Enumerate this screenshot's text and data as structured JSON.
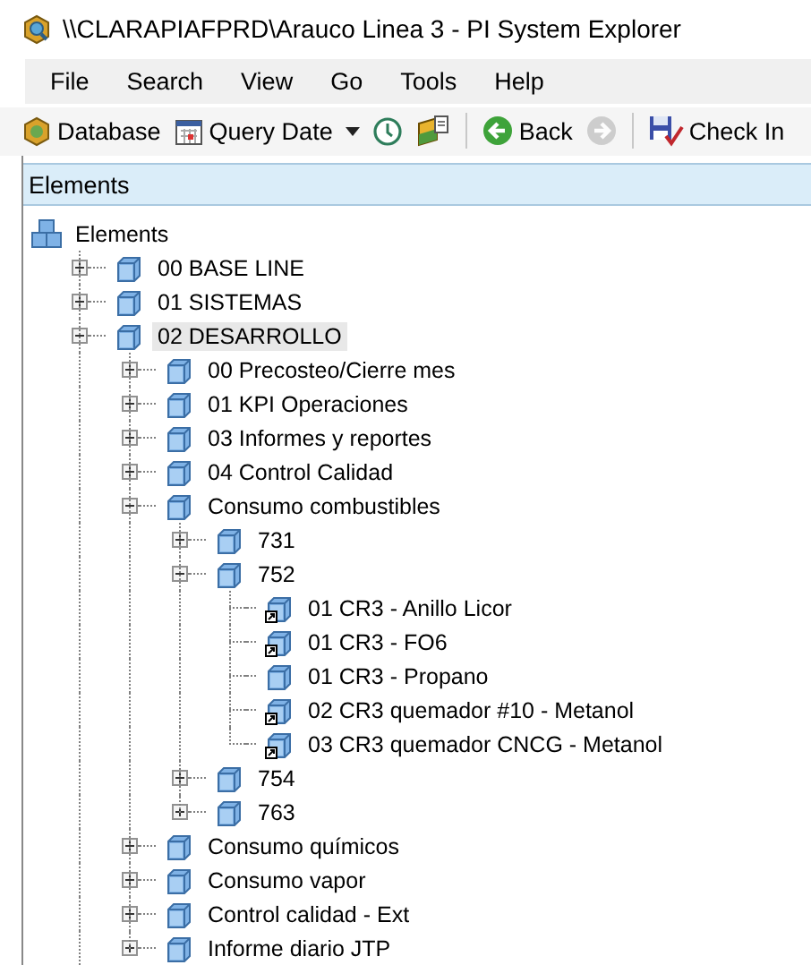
{
  "window": {
    "title": "\\\\CLARAPIAFPRD\\Arauco Linea 3 - PI System Explorer"
  },
  "menu": [
    "File",
    "Search",
    "View",
    "Go",
    "Tools",
    "Help"
  ],
  "toolbar": [
    {
      "kind": "database",
      "label": "Database"
    },
    {
      "kind": "calendar",
      "label": "Query Date"
    },
    {
      "kind": "dropdown"
    },
    {
      "kind": "clock"
    },
    {
      "kind": "layers"
    },
    {
      "kind": "separator"
    },
    {
      "kind": "back",
      "label": "Back",
      "disabled": false
    },
    {
      "kind": "forward",
      "disabled": true
    },
    {
      "kind": "separator"
    },
    {
      "kind": "checkin",
      "label": "Check In"
    }
  ],
  "panel": {
    "title": "Elements"
  },
  "tree": {
    "label": "Elements",
    "children": [
      {
        "label": "00 BASE LINE",
        "kind": "element",
        "expanded": false,
        "selected": false
      },
      {
        "label": "01 SISTEMAS",
        "kind": "element",
        "expanded": false,
        "selected": false
      },
      {
        "label": "02 DESARROLLO",
        "kind": "element",
        "expanded": true,
        "selected": true,
        "children": [
          {
            "label": "00 Precosteo/Cierre mes",
            "kind": "element",
            "expanded": false,
            "selected": false
          },
          {
            "label": "01 KPI Operaciones",
            "kind": "element",
            "expanded": false,
            "selected": false
          },
          {
            "label": "03 Informes y reportes",
            "kind": "element",
            "expanded": false,
            "selected": false
          },
          {
            "label": "04 Control Calidad",
            "kind": "element",
            "expanded": false,
            "selected": false
          },
          {
            "label": "Consumo combustibles",
            "kind": "element",
            "expanded": true,
            "selected": false,
            "children": [
              {
                "label": "731",
                "kind": "element",
                "expanded": false,
                "selected": false
              },
              {
                "label": "752",
                "kind": "element",
                "expanded": true,
                "selected": false,
                "children": [
                  {
                    "label": "01 CR3 - Anillo Licor",
                    "kind": "reference",
                    "selected": false
                  },
                  {
                    "label": "01 CR3 - FO6",
                    "kind": "reference",
                    "selected": false
                  },
                  {
                    "label": "01 CR3 - Propano",
                    "kind": "element",
                    "selected": false
                  },
                  {
                    "label": "02 CR3 quemador #10 - Metanol",
                    "kind": "reference",
                    "selected": false
                  },
                  {
                    "label": "03 CR3 quemador CNCG - Metanol",
                    "kind": "reference",
                    "selected": false
                  }
                ]
              },
              {
                "label": "754",
                "kind": "element",
                "expanded": false,
                "selected": false
              },
              {
                "label": "763",
                "kind": "element",
                "expanded": false,
                "selected": false
              }
            ]
          },
          {
            "label": "Consumo químicos",
            "kind": "element",
            "expanded": false,
            "selected": false
          },
          {
            "label": "Consumo vapor",
            "kind": "element",
            "expanded": false,
            "selected": false
          },
          {
            "label": "Control calidad - Ext",
            "kind": "element",
            "expanded": false,
            "selected": false
          },
          {
            "label": "Informe diario JTP",
            "kind": "element",
            "expanded": false,
            "selected": false
          }
        ]
      }
    ]
  }
}
